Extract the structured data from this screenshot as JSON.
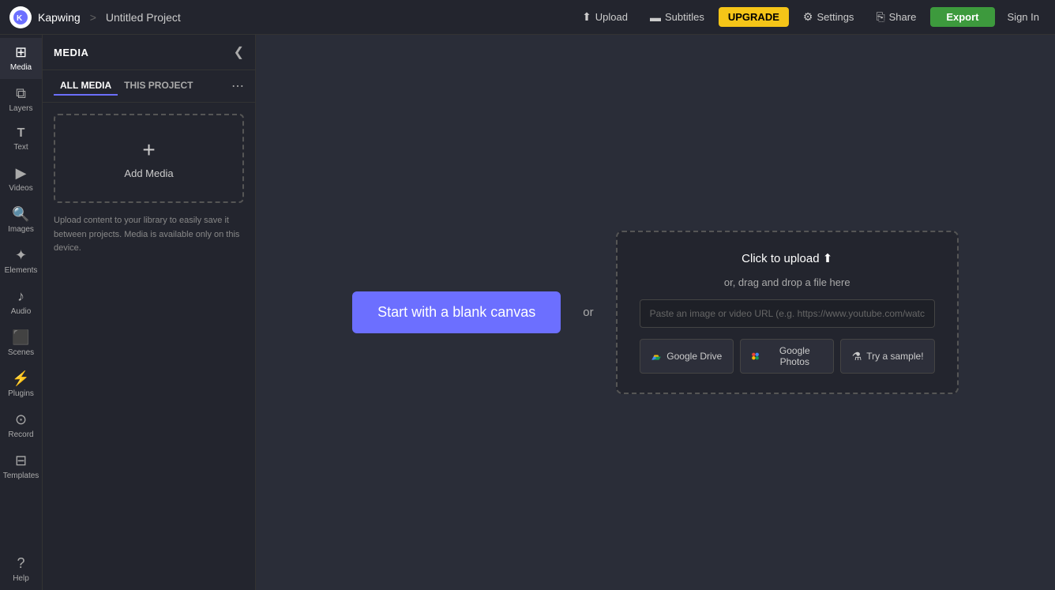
{
  "topbar": {
    "logo_alt": "Kapwing",
    "brand": "Kapwing",
    "separator": ">",
    "project_name": "Untitled Project",
    "upload_label": "Upload",
    "subtitles_label": "Subtitles",
    "upgrade_label": "UPGRADE",
    "settings_label": "Settings",
    "share_label": "Share",
    "export_label": "Export",
    "signin_label": "Sign In"
  },
  "icon_sidebar": {
    "items": [
      {
        "id": "media",
        "label": "Media",
        "icon": "🖼",
        "active": true
      },
      {
        "id": "layers",
        "label": "Layers",
        "icon": "⊞"
      },
      {
        "id": "text",
        "label": "Text",
        "icon": "T"
      },
      {
        "id": "videos",
        "label": "Videos",
        "icon": "▶"
      },
      {
        "id": "images",
        "label": "Images",
        "icon": "🔍"
      },
      {
        "id": "elements",
        "label": "Elements",
        "icon": "✦"
      },
      {
        "id": "audio",
        "label": "Audio",
        "icon": "♪"
      },
      {
        "id": "scenes",
        "label": "Scenes",
        "icon": "⬛"
      },
      {
        "id": "plugins",
        "label": "Plugins",
        "icon": "⚡"
      },
      {
        "id": "record",
        "label": "Record",
        "icon": "⊙"
      },
      {
        "id": "templates",
        "label": "Templates",
        "icon": "⊟"
      }
    ]
  },
  "panel": {
    "title": "MEDIA",
    "collapse_icon": "❮",
    "more_icon": "⋯",
    "tabs": [
      {
        "id": "all_media",
        "label": "ALL MEDIA",
        "active": true
      },
      {
        "id": "this_project",
        "label": "THIS PROJECT",
        "active": false
      }
    ],
    "add_media_label": "Add Media",
    "description": "Upload content to your library to easily save it between projects. Media is available only on this device."
  },
  "canvas": {
    "blank_canvas_label": "Start with a blank canvas",
    "or_label": "or",
    "upload_box": {
      "click_to_upload": "Click to upload",
      "upload_icon": "⬆",
      "drag_text": "or, drag and drop a file here",
      "url_placeholder": "Paste an image or video URL (e.g. https://www.youtube.com/watch?v=C",
      "google_drive_label": "Google Drive",
      "google_photos_label": "Google Photos",
      "try_sample_label": "Try a sample!"
    }
  },
  "help": {
    "label": "Help"
  }
}
